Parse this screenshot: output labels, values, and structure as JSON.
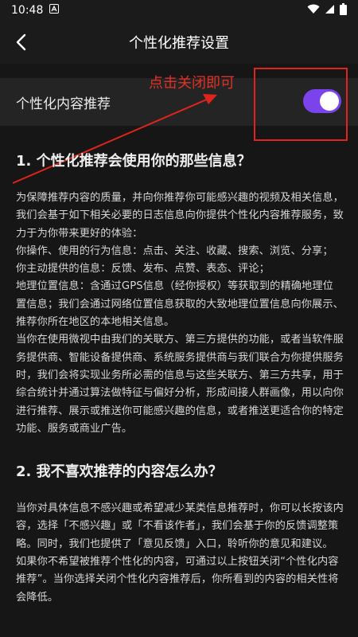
{
  "status_bar": {
    "time": "10:48"
  },
  "app_bar": {
    "title": "个性化推荐设置"
  },
  "setting": {
    "label": "个性化内容推荐",
    "toggle_state": "on",
    "toggle_color": "#7a43ec"
  },
  "annotation": {
    "text": "点击关闭即可",
    "color": "#e0241b"
  },
  "sections": [
    {
      "heading": "1. 个性化推荐会使用你的那些信息？",
      "paragraphs": [
        "为保障推荐内容的质量，并向你推荐你可能感兴趣的视频及相关信息，我们会基于如下相关必要的日志信息向你提供个性化内容推荐服务，致力于为你带来更好的体验：",
        "你操作、使用的行为信息：点击、关注、收藏、搜索、浏览、分享；",
        "你主动提供的信息：反馈、发布、点赞、表态、评论；",
        "地理位置信息：含通过GPS信息（经你授权）等获取到的精确地理位置信息；我们会通过网络位置信息获取的大致地理位置信息向你展示、推荐你所在地区的本地相关信息。",
        "当你在使用微视中由我们的关联方、第三方提供的功能，或者当软件服务提供商、智能设备提供商、系统服务提供商与我们联合为你提供服务时，我们会将实现业务所必需的信息与这些关联方、第三方共享，用于综合统计并通过算法做特征与偏好分析，形成间接人群画像，用以向你进行推荐、展示或推送你可能感兴趣的信息，或者推送更适合你的特定功能、服务或商业广告。"
      ]
    },
    {
      "heading": "2. 我不喜欢推荐的内容怎么办？",
      "paragraphs": [
        "当你对具体信息不感兴趣或希望减少某类信息推荐时，你可以长按该内容，选择「不感兴趣」或「不看该作者」，我们会基于你的反馈调整策略。同时，我们也提供了「意见反馈」入口，聆听你的意见和建议。",
        "如果你不希望被推荐个性化的内容，可通过以上按钮关闭“个性化内容推荐”。当你选择关闭个性化内容推荐后，你所看到的内容的相关性将会降低。"
      ]
    }
  ],
  "icons": {
    "status_left": "notification-a-icon",
    "status_right": [
      "wifi-icon",
      "cellular-signal-icon",
      "battery-icon"
    ],
    "back": "back-arrow-icon"
  }
}
